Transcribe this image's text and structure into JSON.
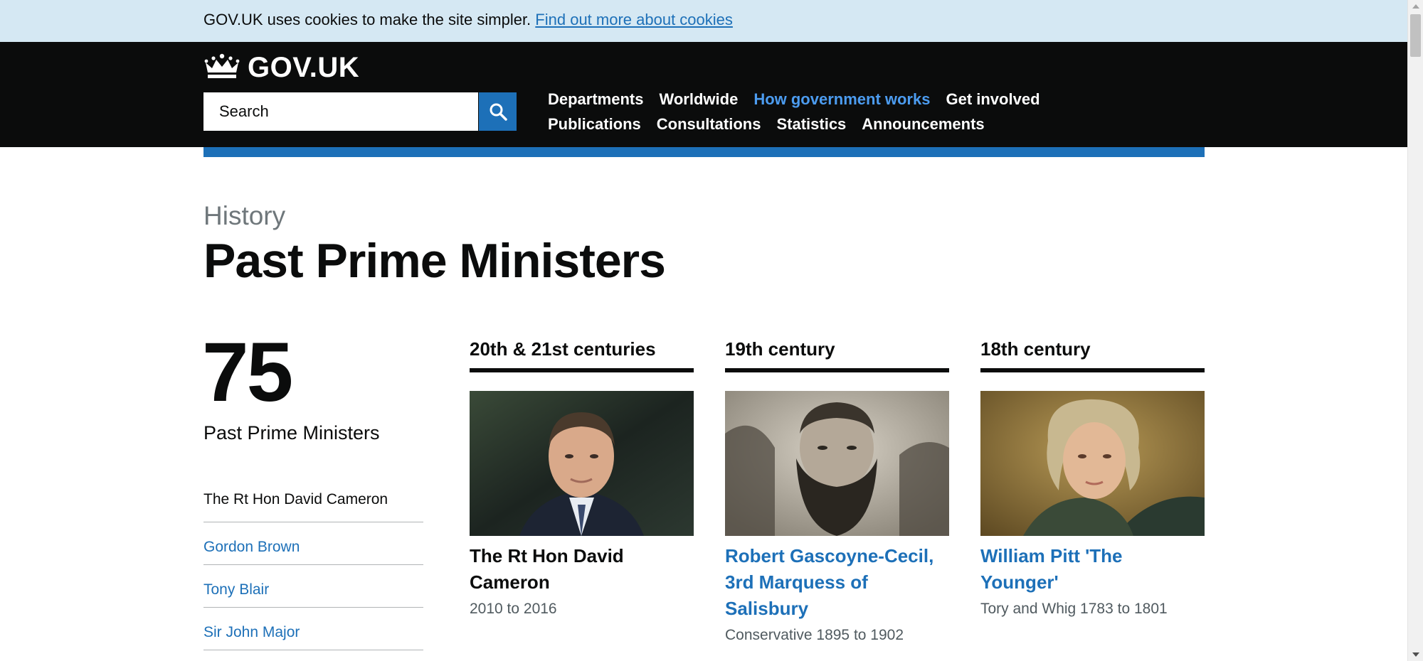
{
  "cookie_banner": {
    "text": "GOV.UK uses cookies to make the site simpler.",
    "link": "Find out more about cookies"
  },
  "header": {
    "logo_text": "GOV.UK",
    "search_placeholder": "Search",
    "nav": [
      {
        "label": "Departments",
        "active": false
      },
      {
        "label": "Worldwide",
        "active": false
      },
      {
        "label": "How government works",
        "active": true
      },
      {
        "label": "Get involved",
        "active": false
      },
      {
        "label": "Publications",
        "active": false
      },
      {
        "label": "Consultations",
        "active": false
      },
      {
        "label": "Statistics",
        "active": false
      },
      {
        "label": "Announcements",
        "active": false
      }
    ]
  },
  "page": {
    "context": "History",
    "title": "Past Prime Ministers"
  },
  "summary": {
    "count": "75",
    "label": "Past Prime Ministers"
  },
  "pm_list": [
    {
      "name": "The Rt Hon David Cameron",
      "link": false
    },
    {
      "name": "Gordon Brown",
      "link": true
    },
    {
      "name": "Tony Blair",
      "link": true
    },
    {
      "name": "Sir John Major",
      "link": true
    }
  ],
  "centuries": [
    {
      "heading": "20th & 21st centuries",
      "name": "The Rt Hon David Cameron",
      "dates": "2010 to 2016",
      "link": false
    },
    {
      "heading": "19th century",
      "name": "Robert Gascoyne-Cecil, 3rd Marquess of Salisbury",
      "dates": "Conservative 1895 to 1902",
      "link": true
    },
    {
      "heading": "18th century",
      "name": "William Pitt 'The Younger'",
      "dates": "Tory and Whig 1783 to 1801",
      "link": true
    }
  ],
  "colors": {
    "brand_blue": "#1d70b8",
    "header_black": "#0b0c0c",
    "cookie_bg": "#d5e8f3",
    "active_nav": "#4c9cf0"
  }
}
